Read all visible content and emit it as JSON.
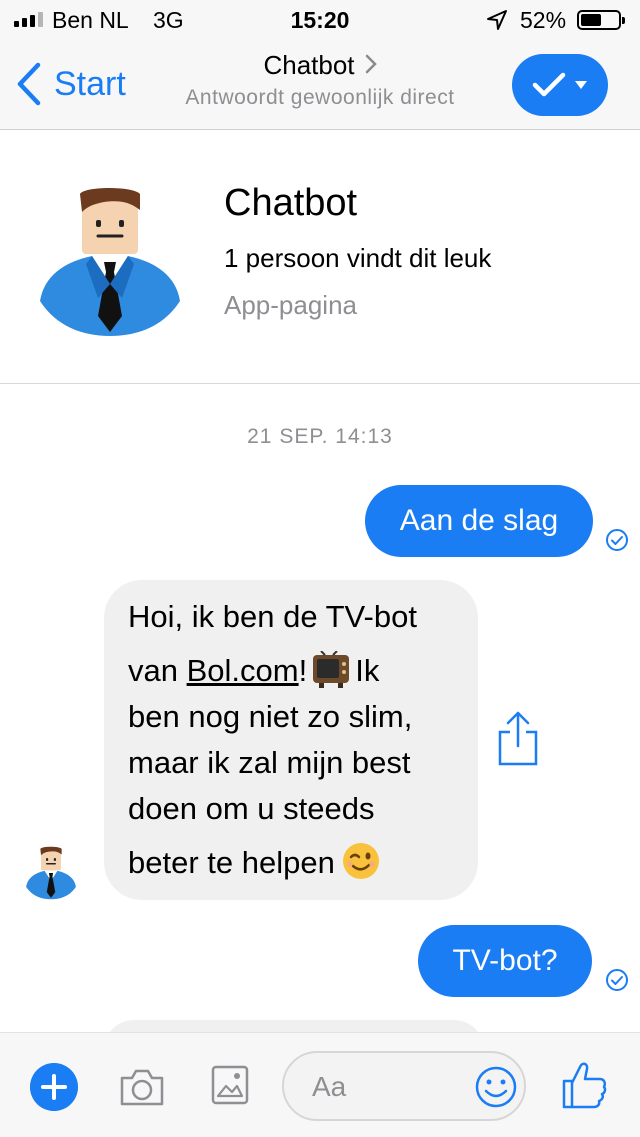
{
  "status_bar": {
    "carrier": "Ben NL",
    "network": "3G",
    "time": "15:20",
    "battery": "52%",
    "battery_level": 0.52,
    "signal_bars": 3
  },
  "nav": {
    "back_label": "Start",
    "title": "Chatbot",
    "subtitle": "Antwoordt gewoonlijk direct"
  },
  "profile": {
    "name": "Chatbot",
    "likes": "1 persoon vindt dit leuk",
    "type": "App-pagina"
  },
  "chat": {
    "timestamp": "21 SEP. 14:13",
    "messages": [
      {
        "from": "user",
        "text": "Aan de slag"
      },
      {
        "from": "bot",
        "lines": {
          "l1": "Hoi, ik ben de TV-bot",
          "l2_pre": "van ",
          "l2_link": "Bol.com",
          "l2_mid": "!",
          "l2_post": "Ik",
          "l3": "ben nog niet zo slim,",
          "l4": "maar ik zal mijn best",
          "l5": "doen om u steeds",
          "l6": "beter te helpen"
        }
      },
      {
        "from": "user",
        "text": "TV-bot?"
      }
    ]
  },
  "composer": {
    "placeholder": "Aa"
  },
  "colors": {
    "accent": "#1b7df4",
    "bubble_in": "#f0f0f0",
    "bar_bg": "#f7f7f7",
    "secondary_text": "#8e8e93"
  },
  "icons": {
    "back": "chevron-left-icon",
    "nav_chevron": "chevron-right-icon",
    "nav_action": "checkmark-dropdown-icon",
    "delivered": "check-circle-icon",
    "share": "share-icon",
    "plus": "plus-icon",
    "camera": "camera-icon",
    "image": "image-icon",
    "emoji": "smiley-icon",
    "like": "thumbs-up-icon"
  }
}
